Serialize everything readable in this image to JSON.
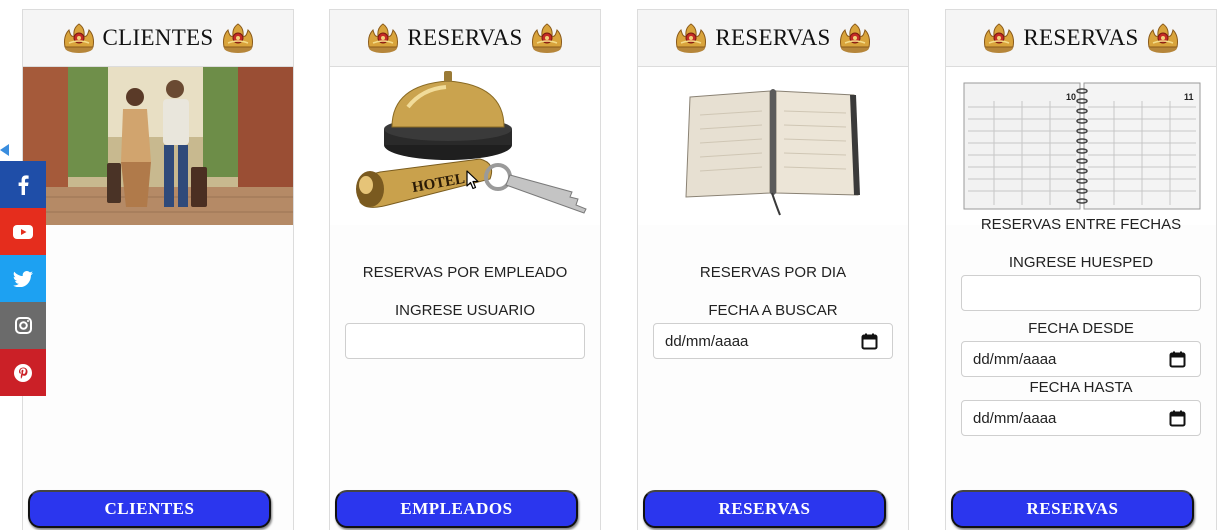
{
  "cards": [
    {
      "title": "CLIENTES",
      "button": "CLIENTES"
    },
    {
      "title": "RESERVAS",
      "subtitle": "RESERVAS POR EMPLEADO",
      "field_label": "INGRESE USUARIO",
      "field_value": "",
      "button": "EMPLEADOS",
      "image_text": "HOTEL"
    },
    {
      "title": "RESERVAS",
      "subtitle": "RESERVAS POR DIA",
      "field_label": "FECHA A BUSCAR",
      "date_value": "dd/mm/aaaa",
      "button": "RESERVAS"
    },
    {
      "title": "RESERVAS",
      "subtitle": "RESERVAS ENTRE FECHAS",
      "field_label_1": "INGRESE HUESPED",
      "field_value_1": "",
      "field_label_2": "FECHA DESDE",
      "date_value_2": "dd/mm/aaaa",
      "field_label_3": "FECHA HASTA",
      "date_value_3": "dd/mm/aaaa",
      "button": "RESERVAS",
      "planner_pages": [
        "10",
        "11"
      ]
    }
  ],
  "social": {
    "items": [
      {
        "icon": "facebook-icon",
        "color": "#1f4ea8"
      },
      {
        "icon": "youtube-icon",
        "color": "#e52d1d"
      },
      {
        "icon": "twitter-icon",
        "color": "#1da1f2"
      },
      {
        "icon": "instagram-icon",
        "color": "#6b6b6b"
      },
      {
        "icon": "pinterest-icon",
        "color": "#cb2027"
      }
    ]
  },
  "colors": {
    "button": "#2b36ee",
    "header": "#f5f5f5",
    "emblem": "#c9932f"
  }
}
